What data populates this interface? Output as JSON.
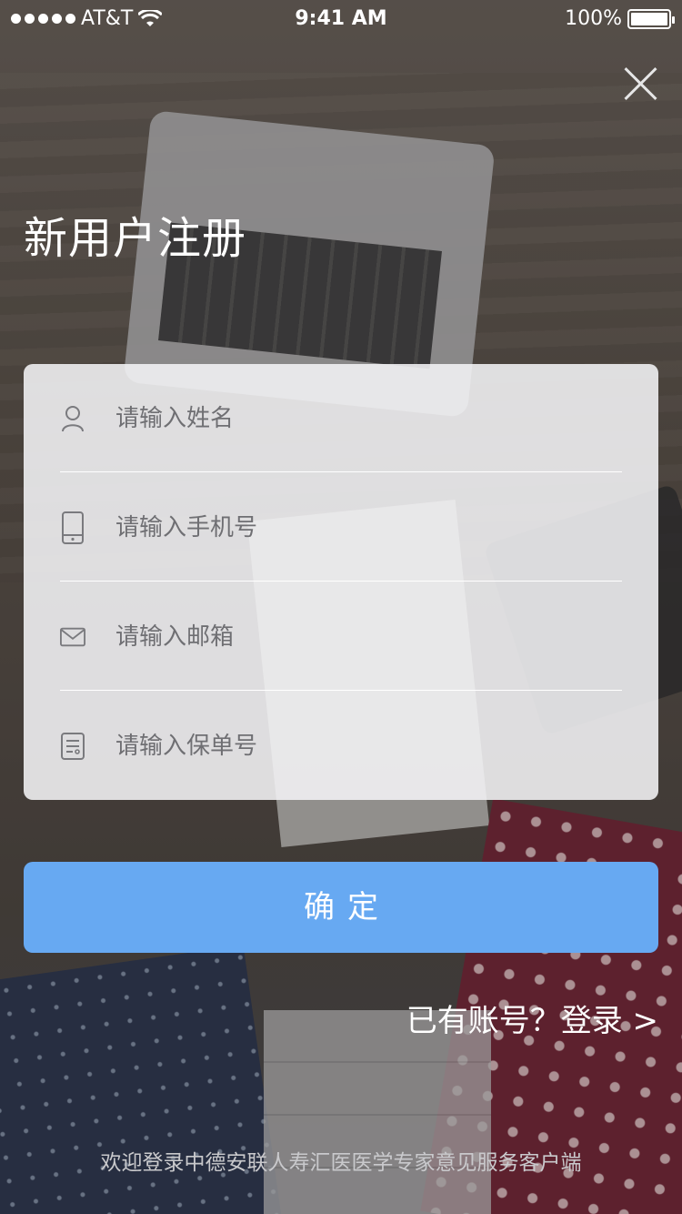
{
  "status_bar": {
    "carrier": "AT&T",
    "time": "9:41 AM",
    "battery": "100%"
  },
  "icons": {
    "close": "close-icon",
    "name": "user-icon",
    "phone": "phone-icon",
    "email": "mail-icon",
    "policy": "document-icon",
    "wifi": "wifi-icon",
    "battery": "battery-icon"
  },
  "page": {
    "title": "新用户注册"
  },
  "form": {
    "name_placeholder": "请输入姓名",
    "phone_placeholder": "请输入手机号",
    "email_placeholder": "请输入邮箱",
    "policy_placeholder": "请输入保单号",
    "confirm_label": "确定"
  },
  "login_link": "已有账号？登录 >",
  "footer_text": "欢迎登录中德安联人寿汇医医学专家意见服务客户端",
  "colors": {
    "primary": "#67a9f2",
    "card": "#f4f4f6"
  }
}
